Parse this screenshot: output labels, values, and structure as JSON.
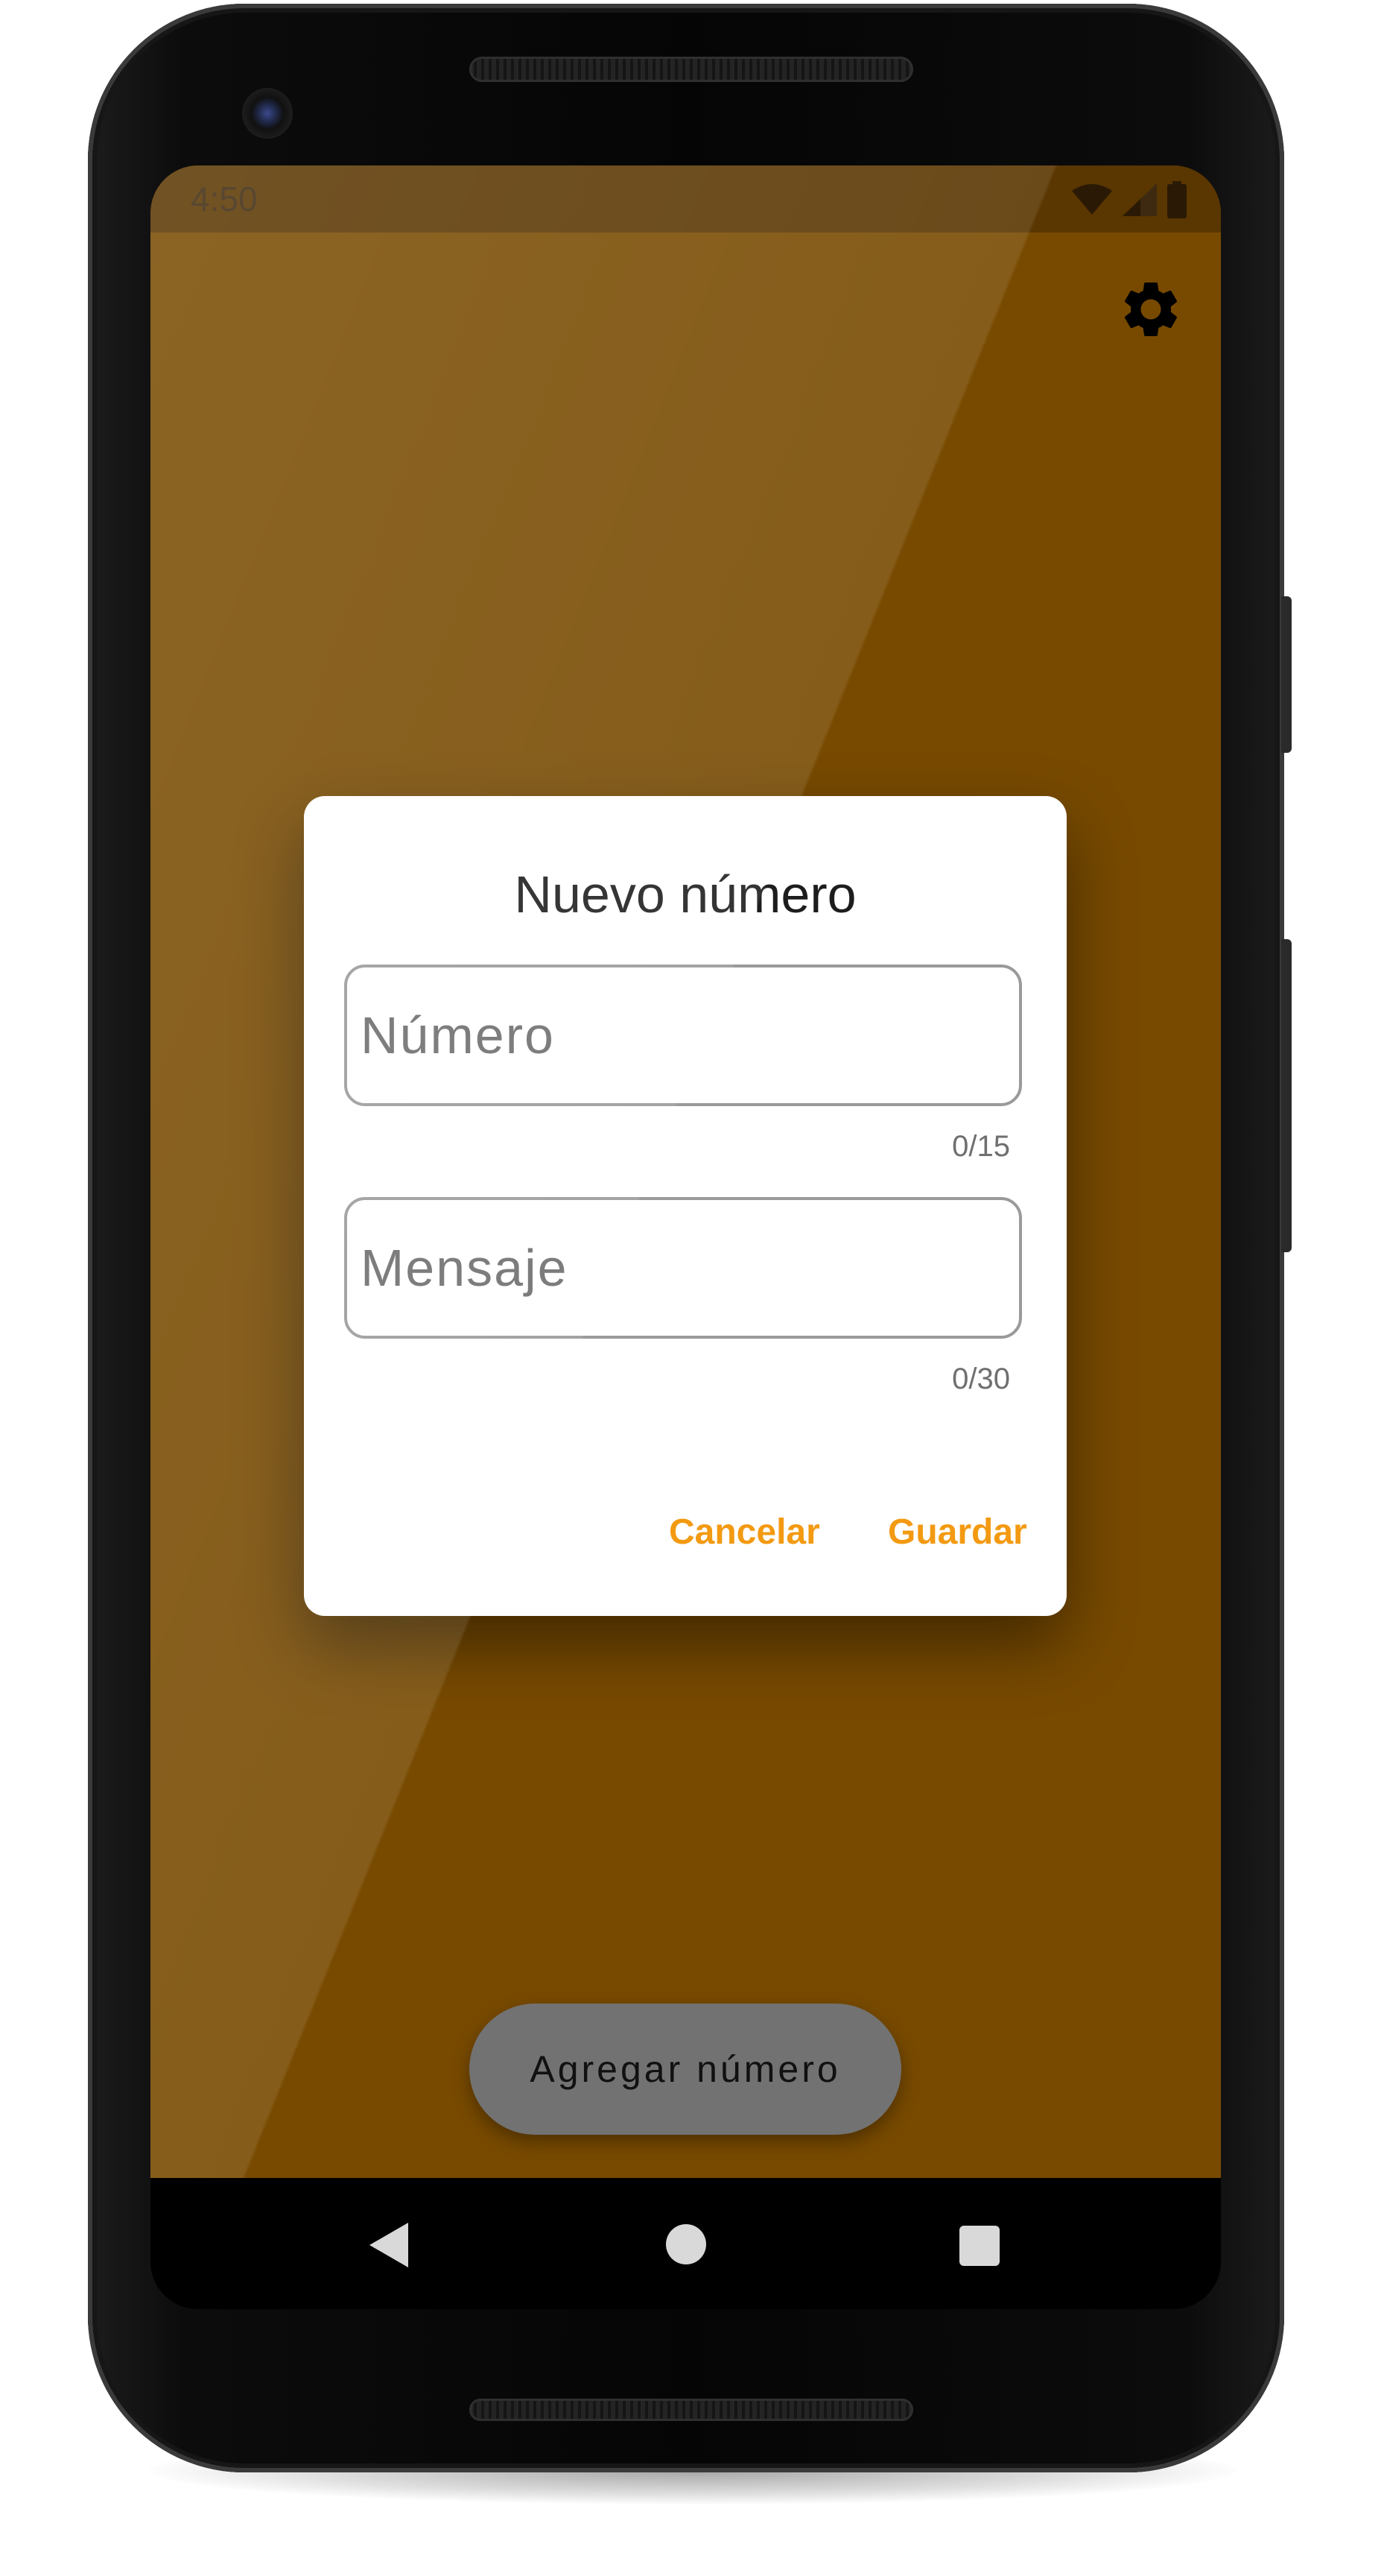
{
  "status_bar": {
    "time": "4:50",
    "icons": [
      "wifi-icon",
      "signal-icon",
      "battery-icon"
    ]
  },
  "toolbar": {
    "settings_icon": "gear-icon"
  },
  "dialog": {
    "title": "Nuevo número",
    "number_field": {
      "placeholder": "Número",
      "value": "",
      "counter": "0/15"
    },
    "message_field": {
      "placeholder": "Mensaje",
      "value": "",
      "counter": "0/30"
    },
    "cancel_label": "Cancelar",
    "save_label": "Guardar"
  },
  "add_button": {
    "label": "Agregar número"
  },
  "navigation": {
    "items": [
      "back-icon",
      "home-icon",
      "recents-icon"
    ]
  },
  "colors": {
    "app_background": "#784a00",
    "status_bar": "#5a3600",
    "accent": "#f39a12",
    "button_background": "#727272",
    "dialog_background": "#ffffff"
  }
}
